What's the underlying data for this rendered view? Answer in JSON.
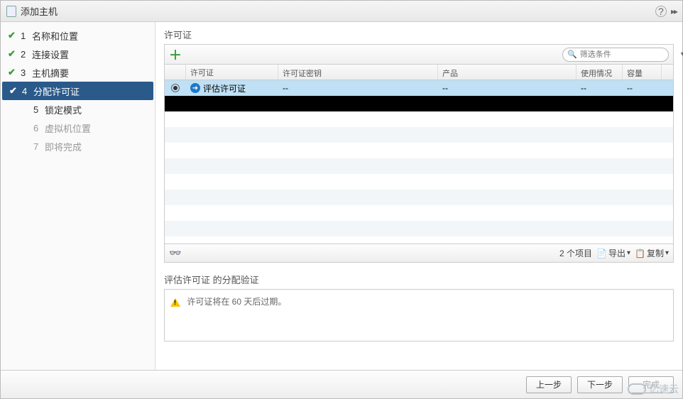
{
  "title": "添加主机",
  "steps": [
    {
      "num": "1",
      "label": "名称和位置",
      "done": true,
      "active": false,
      "disabled": false
    },
    {
      "num": "2",
      "label": "连接设置",
      "done": true,
      "active": false,
      "disabled": false
    },
    {
      "num": "3",
      "label": "主机摘要",
      "done": true,
      "active": false,
      "disabled": false
    },
    {
      "num": "4",
      "label": "分配许可证",
      "done": true,
      "active": true,
      "disabled": false
    },
    {
      "num": "5",
      "label": "锁定模式",
      "done": false,
      "active": false,
      "disabled": false
    },
    {
      "num": "6",
      "label": "虚拟机位置",
      "done": false,
      "active": false,
      "disabled": true
    },
    {
      "num": "7",
      "label": "即将完成",
      "done": false,
      "active": false,
      "disabled": true
    }
  ],
  "section_title": "许可证",
  "filter_placeholder": "筛选条件",
  "columns": {
    "c1": "许可证",
    "c2": "许可证密钥",
    "c3": "产品",
    "c4": "使用情况",
    "c5": "容量"
  },
  "rows": [
    {
      "selected": true,
      "name": "评估许可证",
      "c2": "--",
      "c3": "--",
      "c4": "--",
      "c5": "--"
    }
  ],
  "item_count": "2 个项目",
  "export_label": "导出",
  "copy_label": "复制",
  "validation_title": "评估许可证 的分配验证",
  "validation_msg": "许可证将在 60 天后过期。",
  "buttons": {
    "back": "上一步",
    "next": "下一步",
    "finish": "完成"
  },
  "watermark": "亿速云"
}
